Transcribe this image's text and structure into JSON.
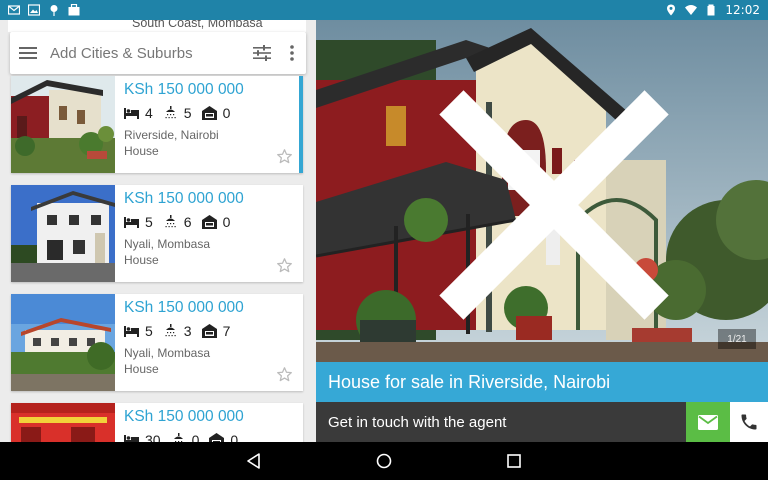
{
  "status": {
    "time": "12:02"
  },
  "peek": {
    "location": "South Coast, Mombasa"
  },
  "search": {
    "placeholder": "Add Cities & Suburbs"
  },
  "listings": [
    {
      "price": "KSh 150 000 000",
      "beds": "4",
      "baths": "5",
      "garage": "0",
      "location": "Riverside, Nairobi",
      "type": "House"
    },
    {
      "price": "KSh 150 000 000",
      "beds": "5",
      "baths": "6",
      "garage": "0",
      "location": "Nyali, Mombasa",
      "type": "House"
    },
    {
      "price": "KSh 150 000 000",
      "beds": "5",
      "baths": "3",
      "garage": "7",
      "location": "Nyali, Mombasa",
      "type": "House"
    },
    {
      "price": "KSh 150 000 000",
      "beds": "30",
      "baths": "0",
      "garage": "0"
    }
  ],
  "detail": {
    "photo_counter": "1/21",
    "title": "House for sale in Riverside, Nairobi",
    "contact_label": "Get in touch with the agent"
  },
  "colors": {
    "accent": "#36a8d6",
    "status_bar": "#1f83a8",
    "mail_green": "#5bbd45"
  }
}
